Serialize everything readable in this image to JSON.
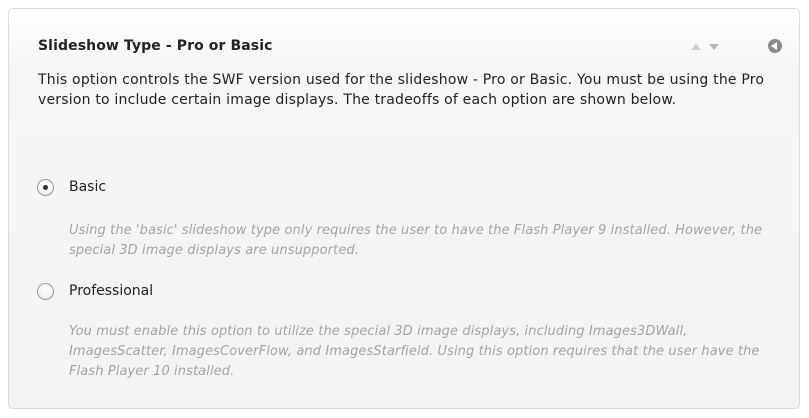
{
  "panel": {
    "title": "Slideshow Type - Pro or Basic",
    "description": "This option controls the SWF version used for the slideshow - Pro or Basic.  You must be using the Pro version to include certain image displays.  The tradeoffs of each option are shown below."
  },
  "options": [
    {
      "label": "Basic",
      "selected": true,
      "hint": "Using the 'basic' slideshow type only requires the user to have the Flash Player 9 installed.  However, the special 3D image displays are unsupported."
    },
    {
      "label": "Professional",
      "selected": false,
      "hint": "You must enable this option to utilize the special 3D image displays, including Images3DWall, ImagesScatter, ImagesCoverFlow, and ImagesStarfield.  Using this option requires that the user have the Flash Player 10 installed."
    }
  ],
  "icons": {
    "move_up": "arrow-up-icon",
    "move_down": "arrow-down-icon",
    "collapse": "collapse-icon"
  },
  "colors": {
    "title": "#222222",
    "hint": "#a3a3a3",
    "panel_border": "#dcdcdc"
  }
}
